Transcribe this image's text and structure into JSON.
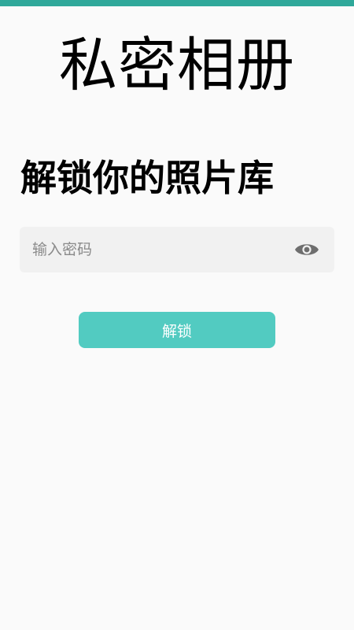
{
  "app": {
    "title": "私密相册",
    "subtitle": "解锁你的照片库"
  },
  "password_field": {
    "placeholder": "输入密码",
    "value": "",
    "toggle_icon": "eye-icon"
  },
  "unlock_button": {
    "label": "解锁"
  },
  "colors": {
    "status_bar": "#2fa89a",
    "accent": "#52cbc1",
    "background": "#fafafa",
    "input_background": "#f1f1f1",
    "icon": "#6e6e6e"
  }
}
